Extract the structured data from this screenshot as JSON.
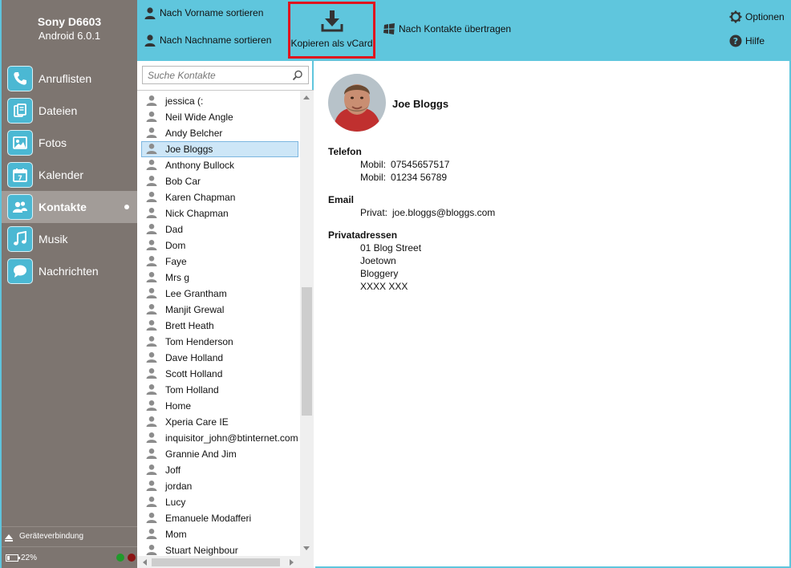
{
  "device": {
    "name": "Sony D6603",
    "os": "Android 6.0.1"
  },
  "nav": [
    {
      "id": "calls",
      "label": "Anruflisten",
      "icon": "phone-icon"
    },
    {
      "id": "files",
      "label": "Dateien",
      "icon": "files-icon"
    },
    {
      "id": "photos",
      "label": "Fotos",
      "icon": "photos-icon"
    },
    {
      "id": "calendar",
      "label": "Kalender",
      "icon": "calendar-icon"
    },
    {
      "id": "contacts",
      "label": "Kontakte",
      "icon": "contacts-icon",
      "active": true
    },
    {
      "id": "music",
      "label": "Musik",
      "icon": "music-icon"
    },
    {
      "id": "messages",
      "label": "Nachrichten",
      "icon": "messages-icon"
    }
  ],
  "connection_label": "Geräteverbindung",
  "battery": "22%",
  "toolbar": {
    "sort_first": "Nach Vorname sortieren",
    "sort_last": "Nach Nachname sortieren",
    "copy_vcard": "Kopieren als vCard",
    "transfer": "Nach Kontakte übertragen",
    "options": "Optionen",
    "help": "Hilfe"
  },
  "search": {
    "placeholder": "Suche Kontakte"
  },
  "contacts": [
    "jessica (:",
    "Neil Wide Angle",
    "Andy Belcher",
    "Joe Bloggs",
    "Anthony Bullock",
    "Bob Car",
    "Karen Chapman",
    "Nick Chapman",
    "Dad",
    "Dom",
    "Faye",
    "Mrs g",
    "Lee Grantham",
    "Manjit Grewal",
    "Brett Heath",
    "Tom Henderson",
    "Dave Holland",
    "Scott Holland",
    "Tom Holland",
    "Home",
    "Xperia Care IE",
    "inquisitor_john@btinternet.com",
    "Grannie And Jim",
    "Joff",
    "jordan",
    "Lucy",
    "Emanuele Modafferi",
    "Mom",
    "Stuart Neighbour"
  ],
  "selected_index": 3,
  "detail": {
    "name": "Joe Bloggs",
    "phone_title": "Telefon",
    "phones": [
      {
        "label": "Mobil:",
        "value": "07545657517"
      },
      {
        "label": "Mobil:",
        "value": "01234 56789"
      }
    ],
    "email_title": "Email",
    "emails": [
      {
        "label": "Privat:",
        "value": "joe.bloggs@bloggs.com"
      }
    ],
    "address_title": "Privatadressen",
    "address_lines": [
      "01 Blog Street",
      "Joetown",
      "Bloggery",
      "XXXX XXX"
    ]
  }
}
